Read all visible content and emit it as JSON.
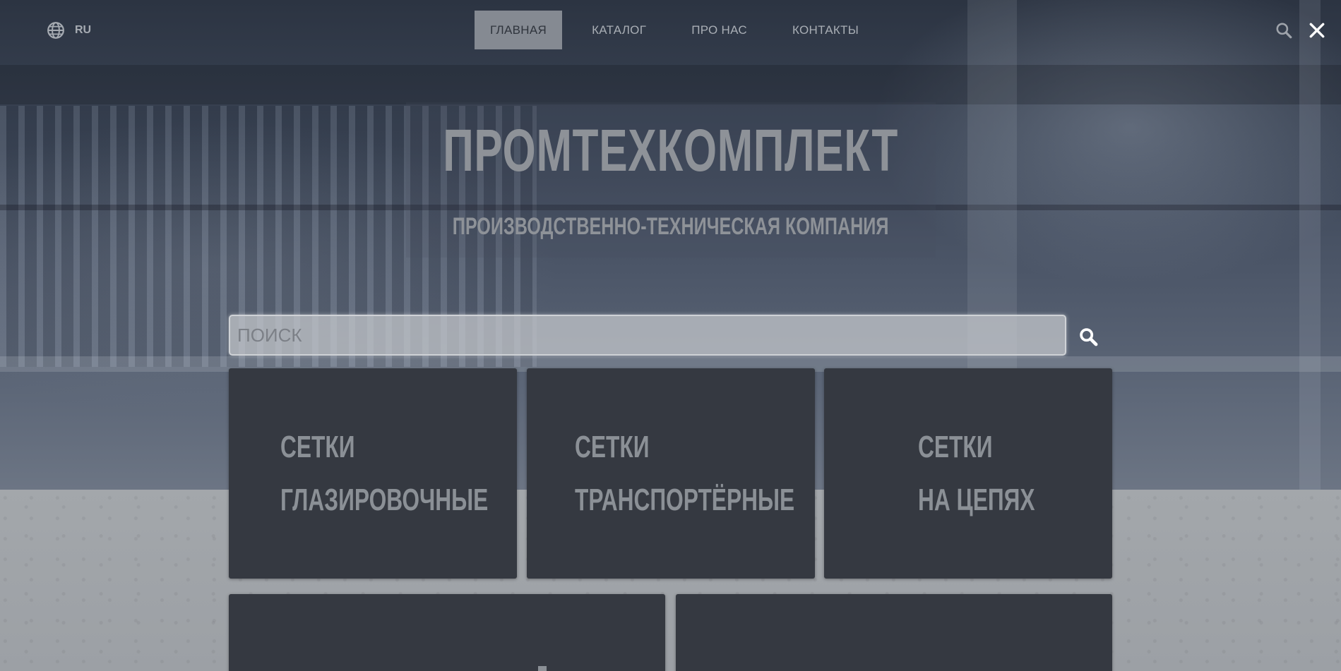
{
  "nav": {
    "language": "RU",
    "menu": [
      {
        "label": "ГЛАВНАЯ",
        "active": true
      },
      {
        "label": "КАТАЛОГ",
        "active": false
      },
      {
        "label": "ПРО НАС",
        "active": false
      },
      {
        "label": "КОНТАКТЫ",
        "active": false
      }
    ],
    "icons": {
      "language": "globe-icon",
      "search": "search-icon",
      "close": "close-icon"
    }
  },
  "hero": {
    "title": "ПРОМТЕХКОМПЛЕКТ",
    "subtitle": "ПРОИЗВОДСТВЕННО-ТЕХНИЧЕСКАЯ КОМПАНИЯ"
  },
  "search": {
    "placeholder": "ПОИСК",
    "value": "",
    "button_icon": "search-icon"
  },
  "categories": [
    {
      "line1": "СЕТКИ",
      "line2": "ГЛАЗИРОВОЧНЫЕ"
    },
    {
      "line1": "СЕТКИ",
      "line2": "ТРАНСПОРТЁРНЫЕ"
    },
    {
      "line1": "СЕТКИ",
      "line2": "НА ЦЕПЯХ"
    }
  ],
  "colors": {
    "card_bg": "#353941",
    "active_nav_bg": "#858a92",
    "text_muted": "#8e9298"
  }
}
